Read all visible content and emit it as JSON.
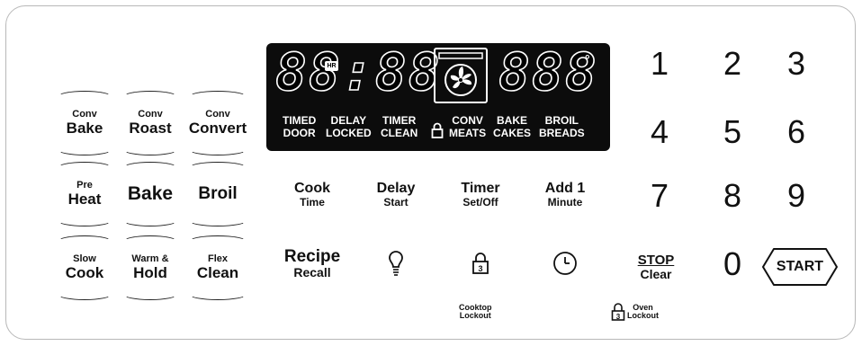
{
  "left_pad": {
    "conv_bake": {
      "top": "Conv",
      "bottom": "Bake"
    },
    "conv_roast": {
      "top": "Conv",
      "bottom": "Roast"
    },
    "conv_convert": {
      "top": "Conv",
      "bottom": "Convert"
    },
    "pre_heat": {
      "top": "Pre",
      "bottom": "Heat"
    },
    "bake": {
      "label": "Bake"
    },
    "broil": {
      "label": "Broil"
    },
    "slow_cook": {
      "top": "Slow",
      "bottom": "Cook"
    },
    "warm_hold": {
      "top": "Warm &",
      "bottom": "Hold"
    },
    "flex_clean": {
      "top": "Flex",
      "bottom": "Clean"
    }
  },
  "display": {
    "time_digits": "88:88",
    "hr_badge": "HR",
    "temp_digits": "888",
    "degree": "°",
    "labels": {
      "timed_door": {
        "top": "TIMED",
        "bottom": "DOOR"
      },
      "delay_locked": {
        "top": "DELAY",
        "bottom": "LOCKED"
      },
      "timer_clean": {
        "top": "TIMER",
        "bottom": "CLEAN"
      },
      "conv_meats": {
        "top": "CONV",
        "bottom": "MEATS"
      },
      "bake_cakes": {
        "top": "BAKE",
        "bottom": "CAKES"
      },
      "broil_breads": {
        "top": "BROIL",
        "bottom": "BREADS"
      }
    }
  },
  "function_buttons": {
    "cook_time": {
      "top": "Cook",
      "bottom": "Time"
    },
    "delay_start": {
      "top": "Delay",
      "bottom": "Start"
    },
    "timer_set_off": {
      "top": "Timer",
      "bottom": "Set/Off"
    },
    "add_1_minute": {
      "top": "Add 1",
      "bottom": "Minute"
    },
    "recipe_recall": {
      "top": "Recipe",
      "bottom": "Recall"
    },
    "cooktop_lockout": "Cooktop\nLockout",
    "stop_clear": {
      "top": "STOP",
      "bottom": "Clear"
    },
    "oven_lockout": "Oven\nLockout",
    "lock_number": "3"
  },
  "keypad": {
    "keys": [
      "1",
      "2",
      "3",
      "4",
      "5",
      "6",
      "7",
      "8",
      "9",
      "0"
    ],
    "start": "START"
  }
}
